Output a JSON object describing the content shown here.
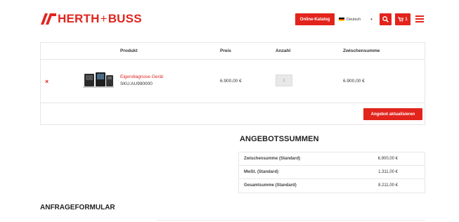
{
  "brand": {
    "name_left": "HERTH",
    "plus": "+",
    "name_right": "BUSS",
    "color": "#e2241d"
  },
  "header": {
    "catalog_button": "Online-Katalog",
    "language": "Deutsch",
    "cart_count": "1"
  },
  "cart": {
    "columns": {
      "product": "Produkt",
      "price": "Preis",
      "quantity": "Anzahl",
      "subtotal": "Zwischensumme"
    },
    "items": [
      {
        "name": "Eigendiagnose Gerät",
        "sku": "SKU:AU990000",
        "price": "6.900,00 €",
        "quantity": "1",
        "subtotal": "6.900,00 €"
      }
    ],
    "update_button": "Angebot aktualisieren"
  },
  "totals": {
    "title": "ANGEBOTSSUMMEN",
    "rows": [
      {
        "label": "Zwischensumme (Standard)",
        "value": "6.900,00 €"
      },
      {
        "label": "MwSt. (Standard)",
        "value": "1.311,00 €"
      },
      {
        "label": "Gesamtsumme (Standard)",
        "value": "8.211,00 €"
      }
    ]
  },
  "inquiry": {
    "title": "ANFRAGEFORMULAR"
  },
  "colors": {
    "accent": "#e2241d",
    "border": "#e6e6e6"
  }
}
